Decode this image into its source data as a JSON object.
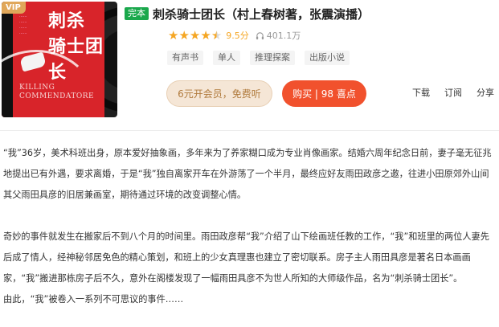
{
  "cover": {
    "vip_label": "VIP",
    "title_line1": "刺杀",
    "title_line2": "骑士团长",
    "english_line1": "KILLING",
    "english_line2": "COMMENDATORE"
  },
  "book": {
    "badge": "完本",
    "title": "刺杀骑士团长（村上春树著，张震演播）",
    "rating": 4.5,
    "score": "9.5分",
    "plays": "401.1万"
  },
  "tags": [
    "有声书",
    "单人",
    "推理探案",
    "出版小说"
  ],
  "buttons": {
    "member": "6元开会员，免费听",
    "buy": "购买 | 98 喜点"
  },
  "actions": {
    "download": "下载",
    "subscribe": "订阅",
    "share": "分享"
  },
  "description": {
    "para1": "“我”36岁，美术科班出身，原本爱好抽象画，多年来为了养家糊口成为专业肖像画家。结婚六周年纪念日前，妻子毫无征兆地提出已有外遇，要求离婚，于是“我”独自离家开车在外游荡了一个半月，最终应好友雨田政彦之邀，往进小田原郊外山间其父雨田具彦的旧居兼画室，期待通过环境的改变调整心情。",
    "para2": "奇妙的事件就发生在搬家后不到八个月的时间里。雨田政彦帮“我”介绍了山下绘画班任教的工作，“我”和班里的两位人妻先后成了情人，经神秘邻居免色的精心策划，和班上的少女真理惠也建立了密切联系。房子主人雨田具彦是著名日本画画家，“我”搬进那栋房子后不久，意外在阁楼发现了一幅雨田具彦不为世人所知的大师级作品，名为“刺杀骑士团长”。",
    "para3": "由此，“我”被卷入一系列不可思议的事件……"
  },
  "colors": {
    "badge_green": "#1aa84c",
    "star": "#f5a623",
    "buy_red": "#f1512d",
    "member_bg": "#f5e6d6",
    "member_text": "#b07a3c"
  }
}
